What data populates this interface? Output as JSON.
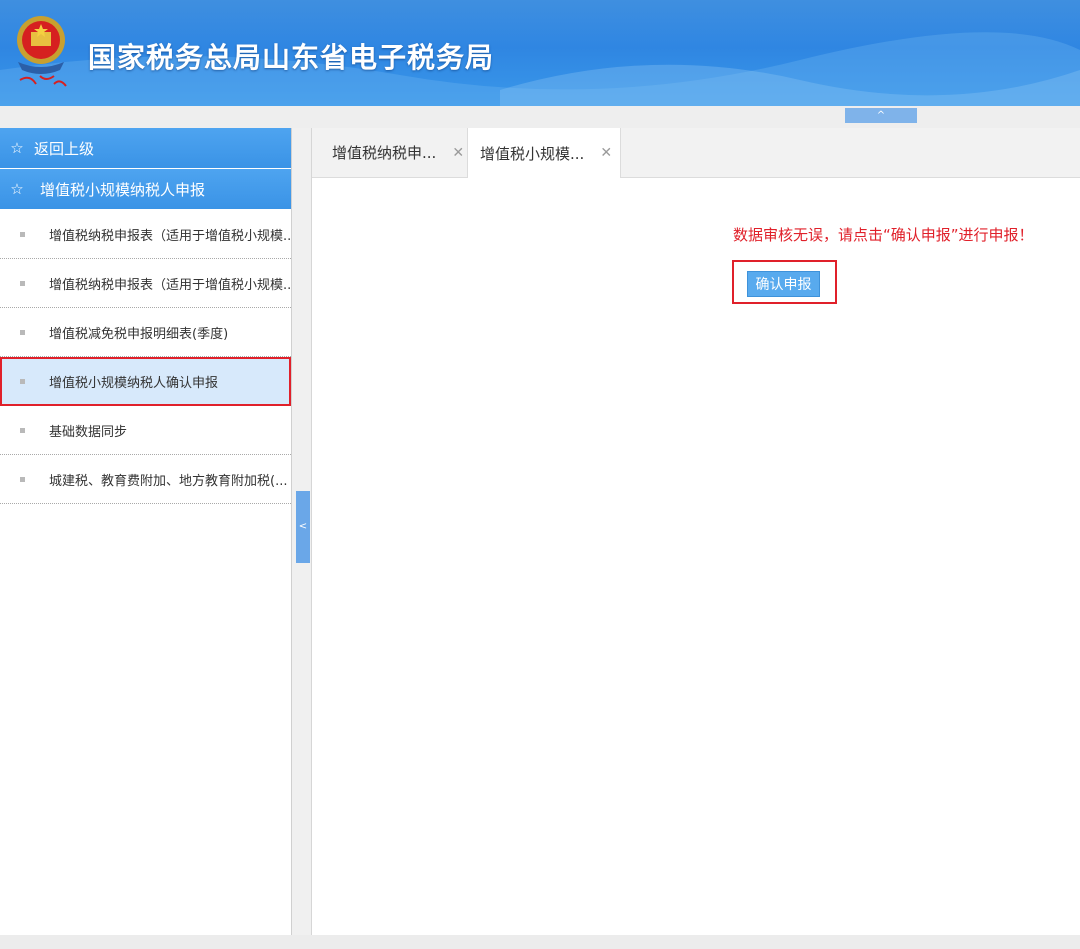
{
  "header": {
    "title": "国家税务总局山东省电子税务局",
    "logo_icon": "tax-emblem-icon"
  },
  "sidebar": {
    "back_label": "返回上级",
    "section_label": "增值税小规模纳税人申报",
    "items": [
      {
        "label": "增值税纳税申报表（适用于增值税小规模..."
      },
      {
        "label": "增值税纳税申报表（适用于增值税小规模..."
      },
      {
        "label": "增值税减免税申报明细表(季度)"
      },
      {
        "label": "增值税小规模纳税人确认申报"
      },
      {
        "label": "基础数据同步"
      },
      {
        "label": "城建税、教育费附加、地方教育附加税(..."
      }
    ]
  },
  "tabs": [
    {
      "label": "增值税纳税申..."
    },
    {
      "label": "增值税小规模..."
    }
  ],
  "main": {
    "notice": "数据审核无误，请点击“确认申报”进行申报！",
    "confirm_button": "确认申报"
  },
  "colors": {
    "accent": "#3a93e6",
    "alert": "#e0202a"
  }
}
